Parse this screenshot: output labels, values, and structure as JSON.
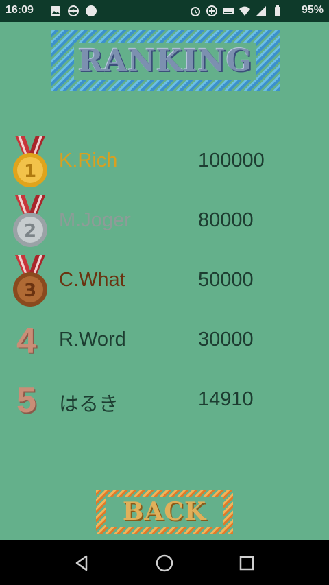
{
  "status_bar": {
    "time": "16:09",
    "battery": "95%",
    "left_icons": [
      "image-icon",
      "game-controller-icon",
      "circle-icon"
    ],
    "right_icons": [
      "alarm-icon",
      "data-saver-icon",
      "keyboard-icon",
      "wifi-icon",
      "signal-icon",
      "battery-icon"
    ]
  },
  "title": "RANKING",
  "rankings": [
    {
      "rank": "1",
      "name": "K.Rich",
      "score": "100000",
      "marker": "gold-medal-icon",
      "name_color": "#d9a020"
    },
    {
      "rank": "2",
      "name": "M.Joger",
      "score": "80000",
      "marker": "silver-medal-icon",
      "name_color": "#8e9c98"
    },
    {
      "rank": "3",
      "name": "C.What",
      "score": "50000",
      "marker": "bronze-medal-icon",
      "name_color": "#6a3210"
    },
    {
      "rank": "4",
      "name": "R.Word",
      "score": "30000",
      "marker": "number-four",
      "name_color": "#1d3d31"
    },
    {
      "rank": "5",
      "name": "はるき",
      "score": "14910",
      "marker": "number-five",
      "name_color": "#1d3d31"
    }
  ],
  "back_label": "BACK",
  "colors": {
    "background": "#64b08b",
    "title_stripe": "#3a8fd0",
    "back_stripe": "#e07a2a"
  },
  "nav_bar": {
    "buttons": [
      "back-triangle-icon",
      "home-circle-icon",
      "recents-square-icon"
    ]
  }
}
